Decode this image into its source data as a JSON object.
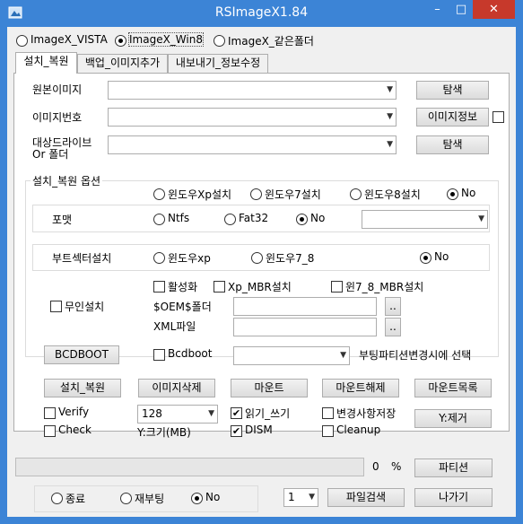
{
  "window": {
    "title": "RSImageX1.84"
  },
  "titlebar": {
    "minimize": "–",
    "maximize": "□",
    "close": "✕"
  },
  "mode": {
    "options": [
      {
        "label": "ImageX_VISTA",
        "selected": false
      },
      {
        "label": "ImageX_Win8",
        "selected": true
      },
      {
        "label": "ImageX_같은폴더",
        "selected": false
      }
    ]
  },
  "tabs": [
    {
      "label": "설치_복원",
      "active": true
    },
    {
      "label": "백업_이미지추가",
      "active": false
    },
    {
      "label": "내보내기_정보수정",
      "active": false
    }
  ],
  "source": {
    "label": "원본이미지",
    "value": "",
    "browse": "탐색"
  },
  "image_index": {
    "label": "이미지번호",
    "value": "",
    "info": "이미지정보"
  },
  "target": {
    "label1": "대상드라이브",
    "label2": "Or 폴더",
    "value": "",
    "browse": "탐색"
  },
  "restore_options": {
    "title": "설치_복원 옵션",
    "win_options": [
      {
        "label": "윈도우Xp설치",
        "selected": false
      },
      {
        "label": "윈도우7설치",
        "selected": false
      },
      {
        "label": "윈도우8설치",
        "selected": false
      },
      {
        "label": "No",
        "selected": true
      }
    ],
    "format": {
      "label": "포맷",
      "options": [
        {
          "label": "Ntfs",
          "selected": false
        },
        {
          "label": "Fat32",
          "selected": false
        },
        {
          "label": "No",
          "selected": true
        }
      ],
      "value": ""
    },
    "bootsector": {
      "label": "부트섹터설치",
      "options": [
        {
          "label": "윈도우xp",
          "selected": false
        },
        {
          "label": "윈도우7_8",
          "selected": false
        },
        {
          "label": "No",
          "selected": true
        }
      ]
    },
    "unattended": {
      "label": "무인설치",
      "activate": "활성화",
      "xp_mbr": "Xp_MBR설치",
      "win78_mbr": "윈7_8_MBR설치",
      "oem_label": "$OEM$폴더",
      "xml_label": "XML파일",
      "dots1": "..",
      "dots2": ".."
    },
    "bcdboot": {
      "button": "BCDBOOT",
      "check_label": "Bcdboot",
      "value": "",
      "hint": "부팅파티션변경시에 선택"
    }
  },
  "actions": {
    "install": "설치_복원",
    "delete": "이미지삭제",
    "mount": "마운트",
    "unmount": "마운트해제",
    "mount_list": "마운트목록"
  },
  "flags": {
    "verify": "Verify",
    "check": "Check",
    "size_value": "128",
    "size_label": "Y:크기(MB)",
    "readwrite": "읽기_쓰기",
    "dism": "DISM",
    "save_changes": "변경사항저장",
    "cleanup": "Cleanup",
    "y_remove": "Y:제거"
  },
  "progress": {
    "value": 0,
    "percent_value": "0",
    "percent_sign": "%",
    "partition": "파티션"
  },
  "footer": {
    "exit_options": [
      {
        "label": "종료",
        "selected": false
      },
      {
        "label": "재부팅",
        "selected": false
      },
      {
        "label": "No",
        "selected": true
      }
    ],
    "count": "1",
    "file_search": "파일검색",
    "exit": "나가기"
  }
}
